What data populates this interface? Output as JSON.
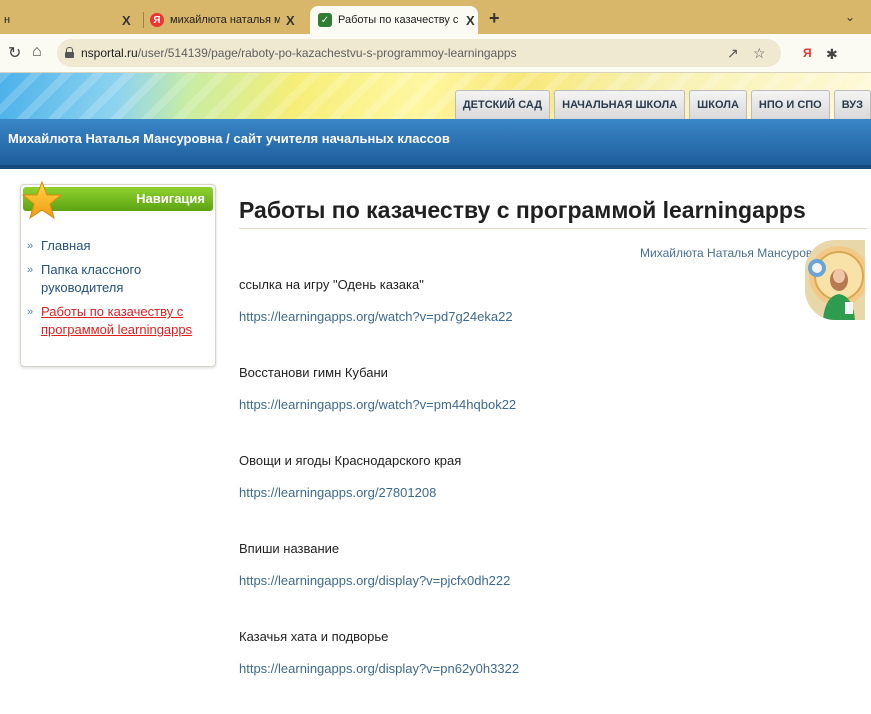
{
  "browser": {
    "tabs": [
      {
        "title": "н",
        "close": "X"
      },
      {
        "favicon": "Я",
        "title": "михайлюта наталья мансуровна",
        "close": "X"
      },
      {
        "favicon": "✓",
        "title": "Работы по казачеству с програм",
        "close": "X"
      }
    ],
    "new_tab": "+",
    "tab_menu": "⌄",
    "url_host": "nsportal.ru",
    "url_path": "/user/514139/page/raboty-po-kazachestvu-s-programmoy-learningapps"
  },
  "site": {
    "top_nav": [
      "ДЕТСКИЙ САД",
      "НАЧАЛЬНАЯ ШКОЛА",
      "ШКОЛА",
      "НПО И СПО",
      "ВУЗ"
    ],
    "header_title": "Михайлюта Наталья Мансуровна / сайт учителя начальных классов"
  },
  "sidebar": {
    "title": "Навигация",
    "items": [
      {
        "label": "Главная",
        "current": false
      },
      {
        "label": "Папка классного руководителя",
        "current": false
      },
      {
        "label": "Работы по казачеству с программой learningapps",
        "current": true
      }
    ]
  },
  "main": {
    "title": "Работы по казачеству с программой learningapps",
    "author": "Михайлюта Наталья Мансуровна",
    "items": [
      {
        "caption": "ссылка на игру \"Одень казака\"",
        "link": "https://learningapps.org/watch?v=pd7g24eka22"
      },
      {
        "caption": "Восстанови гимн Кубани",
        "link": "https://learningapps.org/watch?v=pm44hqbok22"
      },
      {
        "caption": "Овощи и ягоды Краснодарского края",
        "link": "https://learningapps.org/27801208"
      },
      {
        "caption": "Впиши название",
        "link": "https://learningapps.org/display?v=pjcfx0dh222"
      },
      {
        "caption": "Казачья хата и подворье",
        "link": "https://learningapps.org/display?v=pn62y0h3322"
      }
    ]
  },
  "colors": {
    "header": "#1e5e9d",
    "nav_green": "#5da313",
    "link": "#3f6a8f",
    "current_link": "#dd2222",
    "tabbar": "#d8b66a"
  }
}
